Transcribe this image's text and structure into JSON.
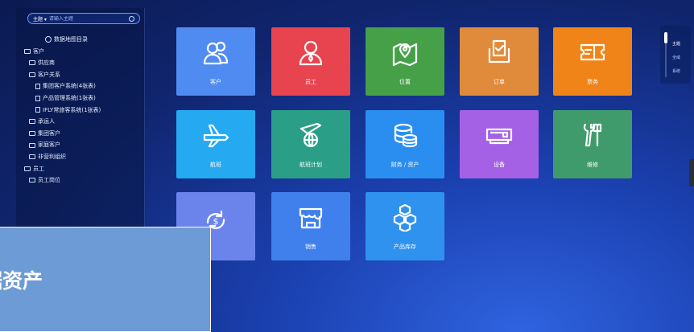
{
  "sidebar": {
    "search": {
      "scope": "主题 ▾",
      "placeholder": "请输入主题"
    },
    "tree": [
      {
        "label": "数据地图目录",
        "level": 0,
        "icon": "catalog-icon"
      },
      {
        "label": "客户",
        "level": 0,
        "icon": "folder-icon"
      },
      {
        "label": "供应商",
        "level": 1,
        "icon": "folder-icon"
      },
      {
        "label": "客户关系",
        "level": 1,
        "icon": "folder-icon"
      },
      {
        "label": "集团客户系统(4张表)",
        "level": 2,
        "icon": "document-icon"
      },
      {
        "label": "产品管理系统(1张表)",
        "level": 2,
        "icon": "document-icon"
      },
      {
        "label": "IFLY常旅客系统(1张表)",
        "level": 2,
        "icon": "document-icon"
      },
      {
        "label": "承运人",
        "level": 1,
        "icon": "folder-icon"
      },
      {
        "label": "集团客户",
        "level": 1,
        "icon": "folder-icon"
      },
      {
        "label": "家庭客户",
        "level": 1,
        "icon": "folder-icon"
      },
      {
        "label": "非营利组织",
        "level": 1,
        "icon": "folder-icon"
      },
      {
        "label": "员工",
        "level": 0,
        "icon": "folder-icon"
      },
      {
        "label": "员工岗位",
        "level": 1,
        "icon": "folder-icon"
      }
    ]
  },
  "tiles": [
    {
      "label": "客户",
      "color": "#4f8bf0",
      "icon": "users-icon"
    },
    {
      "label": "员工",
      "color": "#e8444f",
      "icon": "employee-icon"
    },
    {
      "label": "位置",
      "color": "#45a048",
      "icon": "map-pin-icon"
    },
    {
      "label": "订单",
      "color": "#e08a3c",
      "icon": "order-check-icon"
    },
    {
      "label": "票务",
      "color": "#f08419",
      "icon": "ticket-icon"
    },
    {
      "label": "航班",
      "color": "#25a9f0",
      "icon": "airplane-icon"
    },
    {
      "label": "航班计划",
      "color": "#2b9e87",
      "icon": "flight-plan-icon"
    },
    {
      "label": "财务 / 资产",
      "color": "#2a8ef0",
      "icon": "coins-icon"
    },
    {
      "label": "设备",
      "color": "#a561e6",
      "icon": "device-icon"
    },
    {
      "label": "维修",
      "color": "#3f9a6c",
      "icon": "tools-icon"
    },
    {
      "label": "",
      "color": "#6b84ec",
      "icon": "money-cycle-icon"
    },
    {
      "label": "销售",
      "color": "#3f80ec",
      "icon": "store-icon"
    },
    {
      "label": "产品库存",
      "color": "#2f92ee",
      "icon": "inventory-boxes-icon"
    }
  ],
  "rail": {
    "items": [
      "主题",
      "全域",
      "系统"
    ]
  },
  "banner": {
    "text": "据资产"
  }
}
